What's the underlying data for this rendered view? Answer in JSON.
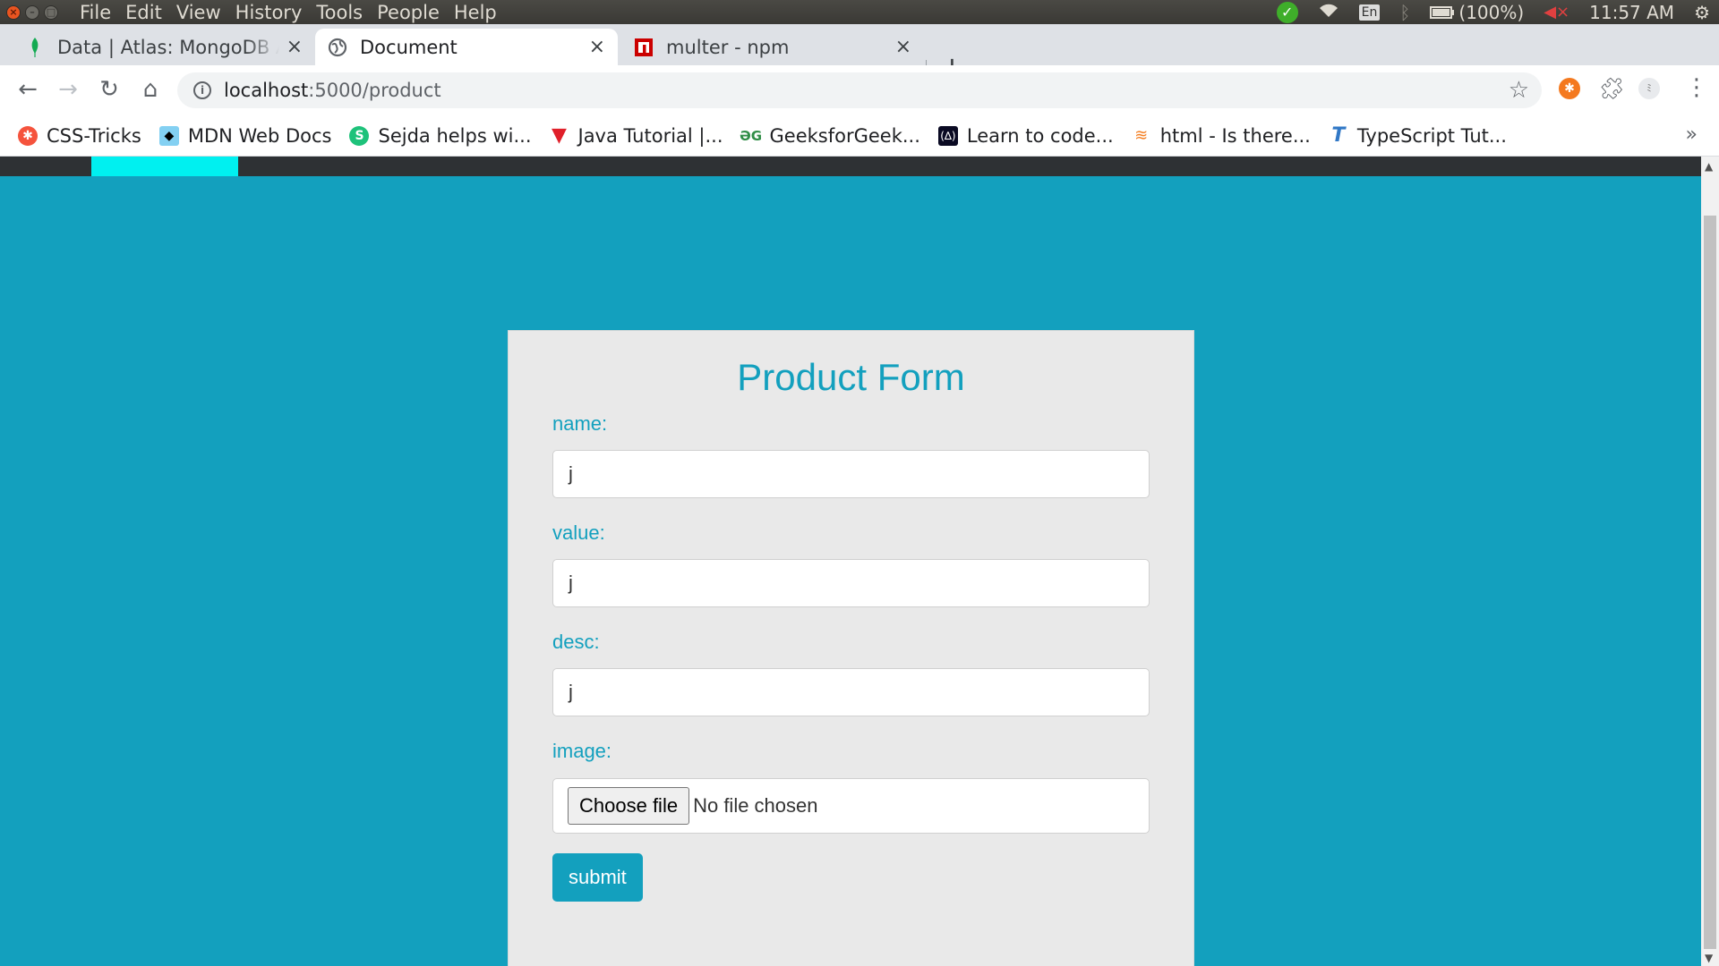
{
  "os": {
    "menus": [
      "File",
      "Edit",
      "View",
      "History",
      "Tools",
      "People",
      "Help"
    ],
    "tray": {
      "lang": "En",
      "battery": "(100%)",
      "time": "11:57 AM"
    }
  },
  "tabs": [
    {
      "title": "Data | Atlas: MongoDB Atlas",
      "icon": "mongodb-leaf-icon"
    },
    {
      "title": "Document",
      "icon": "globe-icon",
      "active": true
    },
    {
      "title": "multer - npm",
      "icon": "npm-icon"
    }
  ],
  "toolbar": {
    "url_host": "localhost",
    "url_path": ":5000/product"
  },
  "bookmarks": [
    {
      "label": "CSS-Tricks",
      "icon": "css-tricks-icon"
    },
    {
      "label": "MDN Web Docs",
      "icon": "mdn-icon"
    },
    {
      "label": "Sejda helps wi...",
      "icon": "sejda-icon"
    },
    {
      "label": "Java Tutorial |...",
      "icon": "java-tutorial-icon"
    },
    {
      "label": "GeeksforGeek...",
      "icon": "geeksforgeeks-icon"
    },
    {
      "label": "Learn to code...",
      "icon": "freecodecamp-icon"
    },
    {
      "label": "html - Is there...",
      "icon": "stackoverflow-icon"
    },
    {
      "label": "TypeScript Tut...",
      "icon": "typescript-icon"
    }
  ],
  "colors": {
    "page_bg": "#13a0be",
    "nav_bar": "#2e3134",
    "nav_active": "#00f0f0",
    "card_bg": "#e9e9e9",
    "accent": "#13a0be"
  },
  "form": {
    "title": "Product Form",
    "name_label": "name:",
    "name_value": "j",
    "value_label": "value:",
    "value_value": "j",
    "desc_label": "desc:",
    "desc_value": "j",
    "image_label": "image:",
    "choose_file": "Choose file",
    "no_file": "No file chosen",
    "submit": "submit"
  }
}
